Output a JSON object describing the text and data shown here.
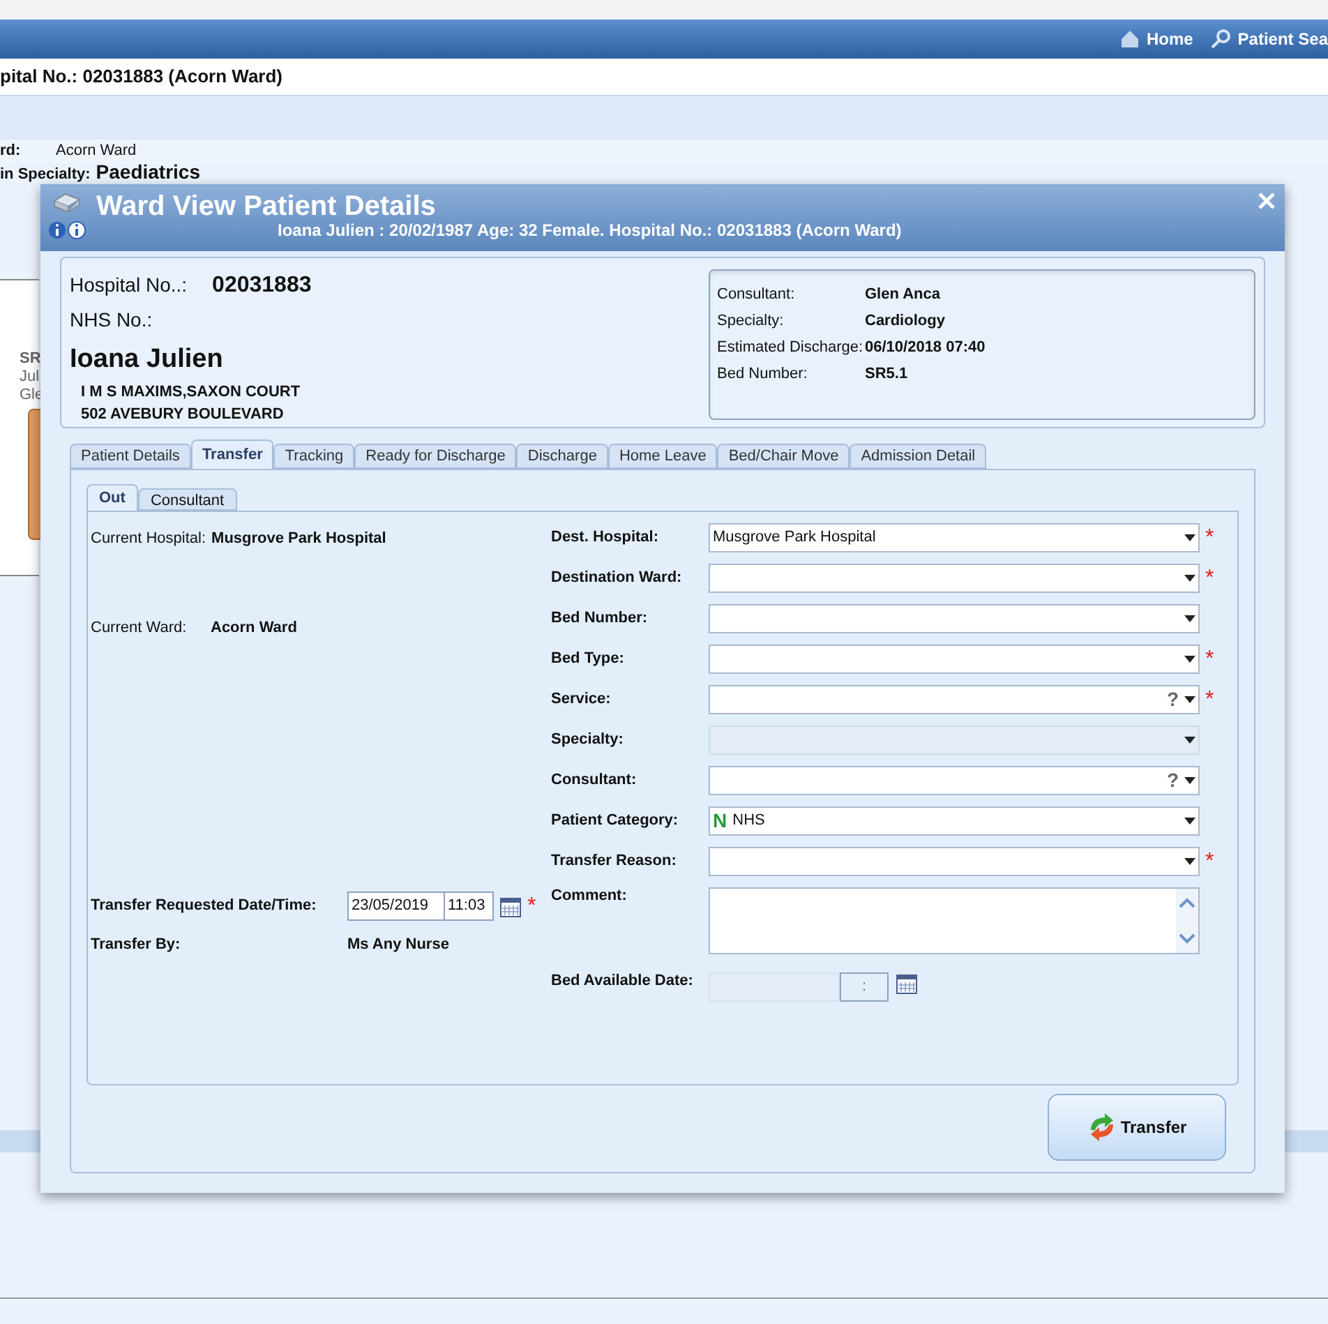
{
  "background": {
    "header_links": [
      {
        "label": "Home",
        "kind": "home"
      },
      {
        "label": "Patient Sea",
        "kind": "search"
      }
    ],
    "title": "pital No.: 02031883 (Acorn Ward)",
    "ward_label": "rd:",
    "ward_value": "Acorn Ward",
    "specialty_label": "in Specialty:",
    "specialty_value": "Paediatrics",
    "side_fragments": [
      "SR",
      "Jul",
      "Gle"
    ]
  },
  "dialog": {
    "title": "Ward View Patient Details",
    "subtitle": "Ioana Julien : 20/02/1987 Age: 32  Female. Hospital No.: 02031883 (Acorn Ward)",
    "patient": {
      "hospital_no_label": "Hospital No..:",
      "hospital_no": "02031883",
      "nhs_label": "NHS No.:",
      "name": "Ioana Julien",
      "address": [
        "I M S MAXIMS,SAXON COURT",
        "502 AVEBURY BOULEVARD"
      ]
    },
    "details": [
      {
        "label": "Consultant:",
        "value": "Glen Anca"
      },
      {
        "label": "Specialty:",
        "value": "Cardiology"
      },
      {
        "label": "Estimated Discharge:",
        "value": "06/10/2018 07:40"
      },
      {
        "label": "Bed Number:",
        "value": "SR5.1"
      }
    ],
    "tabs": [
      {
        "label": "Patient Details",
        "selected": false
      },
      {
        "label": "Transfer",
        "selected": true
      },
      {
        "label": "Tracking",
        "selected": false
      },
      {
        "label": "Ready for Discharge",
        "selected": false
      },
      {
        "label": "Discharge",
        "selected": false
      },
      {
        "label": "Home Leave",
        "selected": false
      },
      {
        "label": "Bed/Chair Move",
        "selected": false
      },
      {
        "label": "Admission Detail",
        "selected": false
      }
    ],
    "subtabs": [
      {
        "label": "Out",
        "selected": true
      },
      {
        "label": "Consultant",
        "selected": false
      }
    ],
    "current_hospital": {
      "label": "Current Hospital:",
      "value": "Musgrove Park Hospital"
    },
    "current_ward": {
      "label": "Current Ward:",
      "value": "Acorn Ward"
    },
    "requested": {
      "label": "Transfer Requested Date/Time:",
      "date": "23/05/2019",
      "time": "11:03",
      "required_mark": "*"
    },
    "transfer_by": {
      "label": "Transfer By:",
      "value": "Ms Any Nurse"
    },
    "fields": [
      {
        "kind": "select",
        "label": "Dest. Hospital:",
        "value": "Musgrove Park Hospital",
        "required_mark": "*",
        "disabled": false
      },
      {
        "kind": "select",
        "label": "Destination Ward:",
        "required_mark": "*",
        "disabled": false
      },
      {
        "kind": "select",
        "label": "Bed Number:",
        "disabled": false
      },
      {
        "kind": "select",
        "label": "Bed Type:",
        "required_mark": "*",
        "disabled": false
      },
      {
        "kind": "select",
        "label": "Service:",
        "help": "?",
        "required_mark": "*",
        "disabled": false
      },
      {
        "kind": "select",
        "label": "Specialty:",
        "disabled": true
      },
      {
        "kind": "select",
        "label": "Consultant:",
        "help": "?",
        "disabled": false
      },
      {
        "kind": "select",
        "label": "Patient Category:",
        "badge": "N",
        "value": "NHS",
        "disabled": false
      },
      {
        "kind": "select",
        "label": "Transfer Reason:",
        "required_mark": "*",
        "disabled": false
      },
      {
        "kind": "textarea",
        "label": "Comment:",
        "disabled": false
      },
      {
        "kind": "datetime",
        "label": "Bed Available Date:",
        "time_separator": ":",
        "disabled": true
      }
    ],
    "button": "Transfer"
  }
}
